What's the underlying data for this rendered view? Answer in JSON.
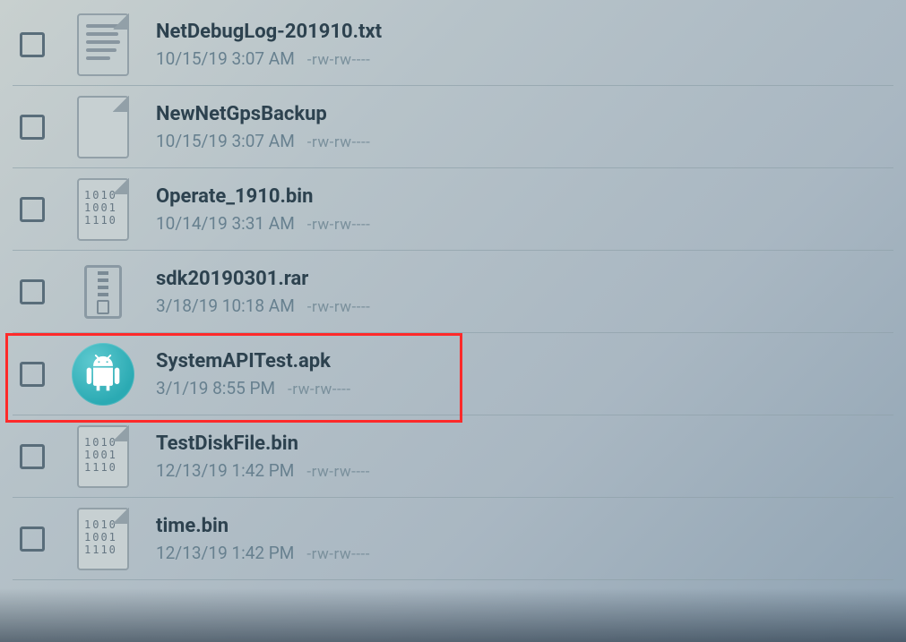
{
  "icon_binary_text": "1010\n1001\n1110",
  "files": [
    {
      "name": "NetDebugLog-201910.txt",
      "date": "10/15/19 3:07 AM",
      "perms": "-rw-rw----",
      "icon": "text"
    },
    {
      "name": "NewNetGpsBackup",
      "date": "10/15/19 3:07 AM",
      "perms": "-rw-rw----",
      "icon": "file"
    },
    {
      "name": "Operate_1910.bin",
      "date": "10/14/19 3:31 AM",
      "perms": "-rw-rw----",
      "icon": "bin"
    },
    {
      "name": "sdk20190301.rar",
      "date": "3/18/19 10:18 AM",
      "perms": "-rw-rw----",
      "icon": "archive"
    },
    {
      "name": "SystemAPITest.apk",
      "date": "3/1/19 8:55 PM",
      "perms": "-rw-rw----",
      "icon": "apk",
      "highlighted": true
    },
    {
      "name": "TestDiskFile.bin",
      "date": "12/13/19 1:42 PM",
      "perms": "-rw-rw----",
      "icon": "bin"
    },
    {
      "name": "time.bin",
      "date": "12/13/19 1:42 PM",
      "perms": "-rw-rw----",
      "icon": "bin"
    }
  ]
}
